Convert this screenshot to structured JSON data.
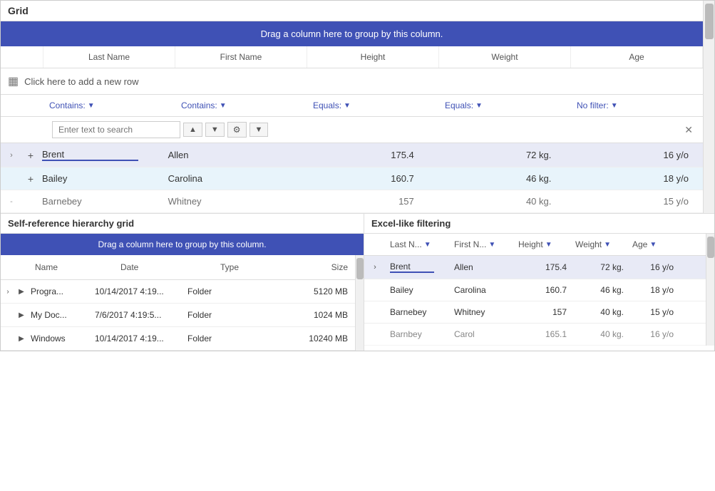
{
  "topSection": {
    "title": "Grid",
    "groupBanner": "Drag a column here to group by this column.",
    "columns": [
      "Last Name",
      "First Name",
      "Height",
      "Weight",
      "Age"
    ],
    "addRowText": "Click here to add a new row",
    "filters": [
      {
        "label": "Contains:",
        "hasArrow": true
      },
      {
        "label": "Contains:",
        "hasArrow": true
      },
      {
        "label": "Equals:",
        "hasArrow": true
      },
      {
        "label": "Equals:",
        "hasArrow": true
      },
      {
        "label": "No filter:",
        "hasArrow": true
      }
    ],
    "searchPlaceholder": "Enter text to search",
    "rows": [
      {
        "expand": "›",
        "add": "+",
        "lastName": "Brent",
        "firstName": "Allen",
        "height": "175.4",
        "weight": "72 kg.",
        "age": "16 y/o",
        "highlighted": true
      },
      {
        "expand": "",
        "add": "+",
        "lastName": "Bailey",
        "firstName": "Carolina",
        "height": "160.7",
        "weight": "46 kg.",
        "age": "18 y/o",
        "highlighted": false
      },
      {
        "expand": "-",
        "add": "",
        "lastName": "Barnebey",
        "firstName": "Whitney",
        "height": "157",
        "weight": "40 kg.",
        "age": "15 y/o",
        "highlighted": false
      }
    ]
  },
  "bottomLeft": {
    "title": "Self-reference hierarchy grid",
    "groupBanner": "Drag a column here to group by this column.",
    "columns": [
      "Name",
      "Date",
      "Type",
      "Size"
    ],
    "rows": [
      {
        "outerExpand": "›",
        "innerExpand": "▶",
        "name": "Progra...",
        "date": "10/14/2017 4:19...",
        "type": "Folder",
        "size": "5120 MB"
      },
      {
        "outerExpand": "",
        "innerExpand": "▶",
        "name": "My Doc...",
        "date": "7/6/2017 4:19:5...",
        "type": "Folder",
        "size": "1024 MB"
      },
      {
        "outerExpand": "",
        "innerExpand": "▶",
        "name": "Windows",
        "date": "10/14/2017 4:19...",
        "type": "Folder",
        "size": "10240 MB"
      }
    ]
  },
  "bottomRight": {
    "title": "Excel-like filtering",
    "columns": [
      {
        "label": "Last N...",
        "hasFilter": true
      },
      {
        "label": "First N...",
        "hasFilter": true
      },
      {
        "label": "Height",
        "hasFilter": true
      },
      {
        "label": "Weight",
        "hasFilter": true
      },
      {
        "label": "Age",
        "hasFilter": true
      }
    ],
    "rows": [
      {
        "expand": "›",
        "lastName": "Brent",
        "firstName": "Allen",
        "height": "175.4",
        "weight": "72 kg.",
        "age": "16 y/o",
        "highlighted": true
      },
      {
        "expand": "",
        "lastName": "Bailey",
        "firstName": "Carolina",
        "height": "160.7",
        "weight": "46 kg.",
        "age": "18 y/o",
        "highlighted": false
      },
      {
        "expand": "",
        "lastName": "Barnebey",
        "firstName": "Whitney",
        "height": "157",
        "weight": "40 kg.",
        "age": "15 y/o",
        "highlighted": false
      },
      {
        "expand": "",
        "lastName": "Barnbey",
        "firstName": "Carol",
        "height": "165.1",
        "weight": "40 kg.",
        "age": "16 y/o",
        "highlighted": false
      }
    ]
  },
  "icons": {
    "expand": "›",
    "collapse": "▸",
    "arrowUp": "▲",
    "arrowDown": "▼",
    "gear": "⚙",
    "close": "✕",
    "table": "▦",
    "filterArrow": "▼"
  }
}
